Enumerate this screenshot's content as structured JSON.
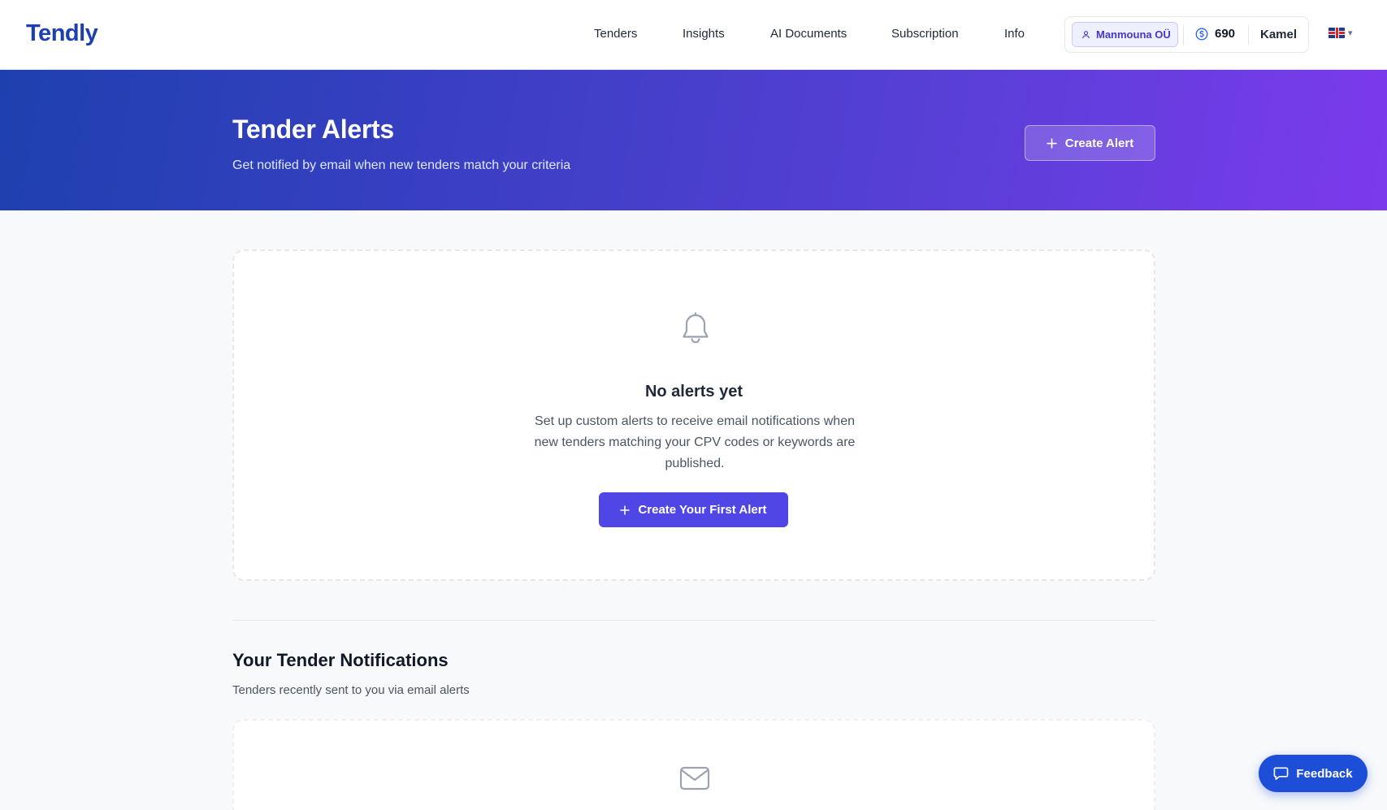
{
  "brand": {
    "logo": "Tendly"
  },
  "nav": {
    "items": [
      {
        "label": "Tenders"
      },
      {
        "label": "Insights"
      },
      {
        "label": "AI Documents"
      },
      {
        "label": "Subscription"
      },
      {
        "label": "Info"
      }
    ]
  },
  "account": {
    "company": "Manmouna OÜ",
    "credits": "690",
    "user": "Kamel",
    "language_flag": "uk-flag-icon",
    "language_caret": "▾"
  },
  "hero": {
    "title": "Tender Alerts",
    "subtitle": "Get notified by email when new tenders match your criteria",
    "create_button": "Create Alert"
  },
  "empty_state": {
    "icon": "bell-icon",
    "title": "No alerts yet",
    "description": "Set up custom alerts to receive email notifications when new tenders matching your CPV codes or keywords are published.",
    "button": "Create Your First Alert"
  },
  "notifications": {
    "title": "Your Tender Notifications",
    "subtitle": "Tenders recently sent to you via email alerts",
    "icon": "mail-icon"
  },
  "feedback": {
    "label": "Feedback"
  },
  "colors": {
    "brand": "#1e40af",
    "accent": "#4f46e5",
    "hero_start": "#1e40af",
    "hero_end": "#7c3aed",
    "feedback": "#1d4ed8"
  }
}
